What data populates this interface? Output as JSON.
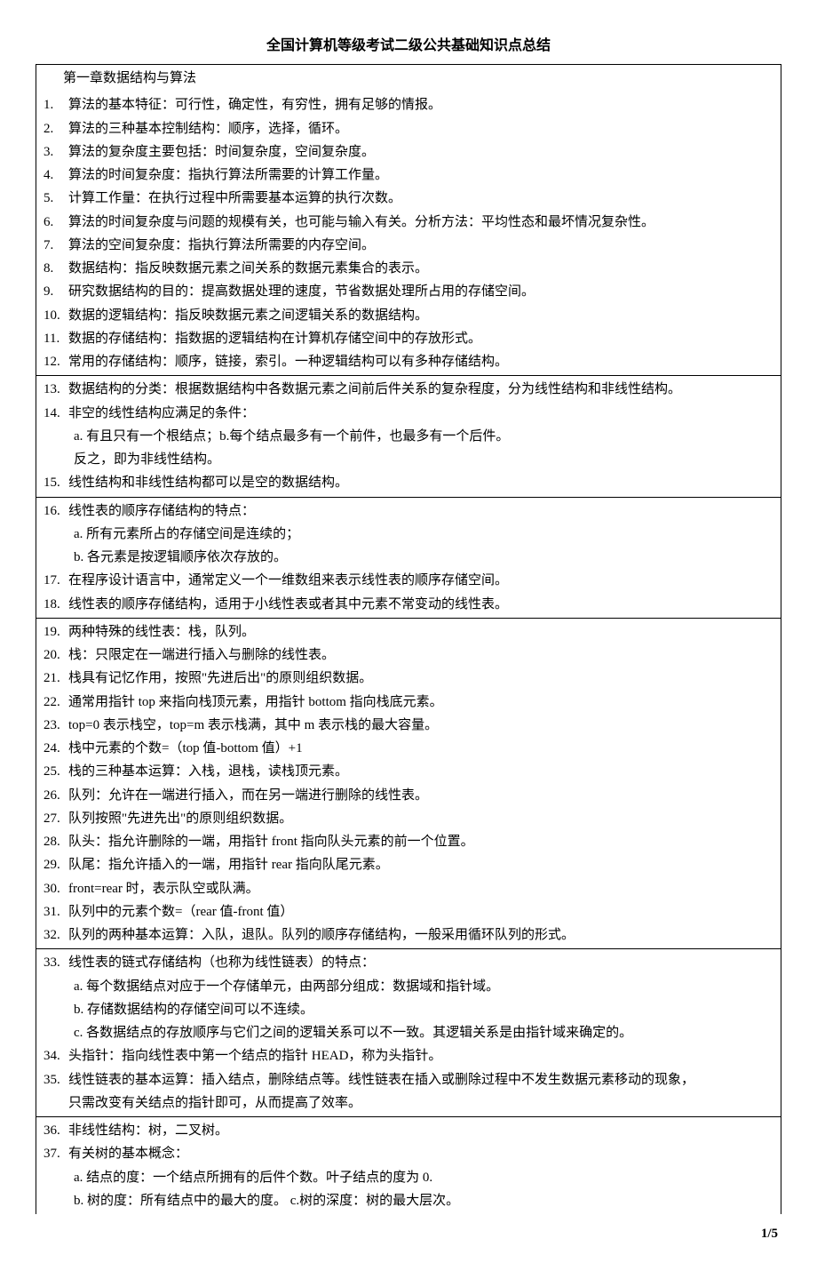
{
  "title": "全国计算机等级考试二级公共基础知识点总结",
  "chapter": "第一章数据结构与算法",
  "b1": [
    {
      "n": "1.",
      "t": "算法的基本特征：可行性，确定性，有穷性，拥有足够的情报。"
    },
    {
      "n": "2.",
      "t": "算法的三种基本控制结构：顺序，选择，循环。"
    },
    {
      "n": "3.",
      "t": "算法的复杂度主要包括：时间复杂度，空间复杂度。"
    },
    {
      "n": "4.",
      "t": "算法的时间复杂度：指执行算法所需要的计算工作量。"
    },
    {
      "n": "5.",
      "t": "计算工作量：在执行过程中所需要基本运算的执行次数。"
    },
    {
      "n": "6.",
      "t": "算法的时间复杂度与问题的规模有关，也可能与输入有关。分析方法：平均性态和最坏情况复杂性。"
    },
    {
      "n": "7.",
      "t": "算法的空间复杂度：指执行算法所需要的内存空间。"
    },
    {
      "n": "8.",
      "t": "数据结构：指反映数据元素之间关系的数据元素集合的表示。"
    },
    {
      "n": "9.",
      "t": "研究数据结构的目的：提高数据处理的速度，节省数据处理所占用的存储空间。"
    },
    {
      "n": "10.",
      "t": "数据的逻辑结构：指反映数据元素之间逻辑关系的数据结构。"
    },
    {
      "n": "11.",
      "t": "数据的存储结构：指数据的逻辑结构在计算机存储空间中的存放形式。"
    },
    {
      "n": "12.",
      "t": "常用的存储结构：顺序，链接，索引。一种逻辑结构可以有多种存储结构。"
    }
  ],
  "b2": [
    {
      "n": "13.",
      "t": "数据结构的分类：根据数据结构中各数据元素之间前后件关系的复杂程度，分为线性结构和非线性结构。"
    },
    {
      "n": "14.",
      "t": "非空的线性结构应满足的条件："
    }
  ],
  "b2sub": [
    "a.   有且只有一个根结点；b.每个结点最多有一个前件，也最多有一个后件。",
    "反之，即为非线性结构。"
  ],
  "b2after": [
    {
      "n": "15.",
      "t": "线性结构和非线性结构都可以是空的数据结构。"
    }
  ],
  "b3": [
    {
      "n": "16.",
      "t": "线性表的顺序存储结构的特点："
    }
  ],
  "b3sub": [
    "a.   所有元素所占的存储空间是连续的；",
    "b.   各元素是按逻辑顺序依次存放的。"
  ],
  "b3after": [
    {
      "n": "17.",
      "t": "在程序设计语言中，通常定义一个一维数组来表示线性表的顺序存储空间。"
    },
    {
      "n": "18.",
      "t": "线性表的顺序存储结构，适用于小线性表或者其中元素不常变动的线性表。"
    }
  ],
  "b4": [
    {
      "n": "19.",
      "t": "两种特殊的线性表：栈，队列。"
    },
    {
      "n": "20.",
      "t": "栈：只限定在一端进行插入与删除的线性表。"
    },
    {
      "n": "21.",
      "t": "栈具有记忆作用，按照\"先进后出\"的原则组织数据。"
    },
    {
      "n": "22.",
      "t": "通常用指针 top 来指向栈顶元素，用指针 bottom 指向栈底元素。"
    },
    {
      "n": "23.",
      "t": "top=0 表示栈空，top=m 表示栈满，其中 m 表示栈的最大容量。"
    },
    {
      "n": "24.",
      "t": "栈中元素的个数=（top 值-bottom 值）+1"
    },
    {
      "n": "25.",
      "t": "栈的三种基本运算：入栈，退栈，读栈顶元素。"
    },
    {
      "n": "26.",
      "t": "队列：允许在一端进行插入，而在另一端进行删除的线性表。"
    },
    {
      "n": "27.",
      "t": "队列按照\"先进先出\"的原则组织数据。"
    },
    {
      "n": "28.",
      "t": "队头：指允许删除的一端，用指针 front 指向队头元素的前一个位置。"
    },
    {
      "n": "29.",
      "t": "队尾：指允许插入的一端，用指针 rear 指向队尾元素。"
    },
    {
      "n": "30.",
      "t": "front=rear 时，表示队空或队满。"
    },
    {
      "n": "31.",
      "t": "队列中的元素个数=（rear 值-front 值）"
    },
    {
      "n": "32.",
      "t": "队列的两种基本运算：入队，退队。队列的顺序存储结构，一般采用循环队列的形式。"
    }
  ],
  "b5": [
    {
      "n": "33.",
      "t": "线性表的链式存储结构（也称为线性链表）的特点："
    }
  ],
  "b5sub": [
    "a.   每个数据结点对应于一个存储单元，由两部分组成：数据域和指针域。",
    "b.   存储数据结构的存储空间可以不连续。",
    "c.   各数据结点的存放顺序与它们之间的逻辑关系可以不一致。其逻辑关系是由指针域来确定的。"
  ],
  "b5after": [
    {
      "n": "34.",
      "t": "头指针：指向线性表中第一个结点的指针 HEAD，称为头指针。"
    },
    {
      "n": "35.",
      "t": "线性链表的基本运算：插入结点，删除结点等。线性链表在插入或删除过程中不发生数据元素移动的现象，只需改变有关结点的指针即可，从而提高了效率。",
      "cont": true
    }
  ],
  "b6": [
    {
      "n": "36.",
      "t": "非线性结构：树，二叉树。"
    },
    {
      "n": "37.",
      "t": "有关树的基本概念："
    }
  ],
  "b6sub": [
    "a.   结点的度：一个结点所拥有的后件个数。叶子结点的度为 0.",
    "b.   树的度：所有结点中的最大的度。       c.树的深度：树的最大层次。"
  ],
  "footer": "1/5"
}
